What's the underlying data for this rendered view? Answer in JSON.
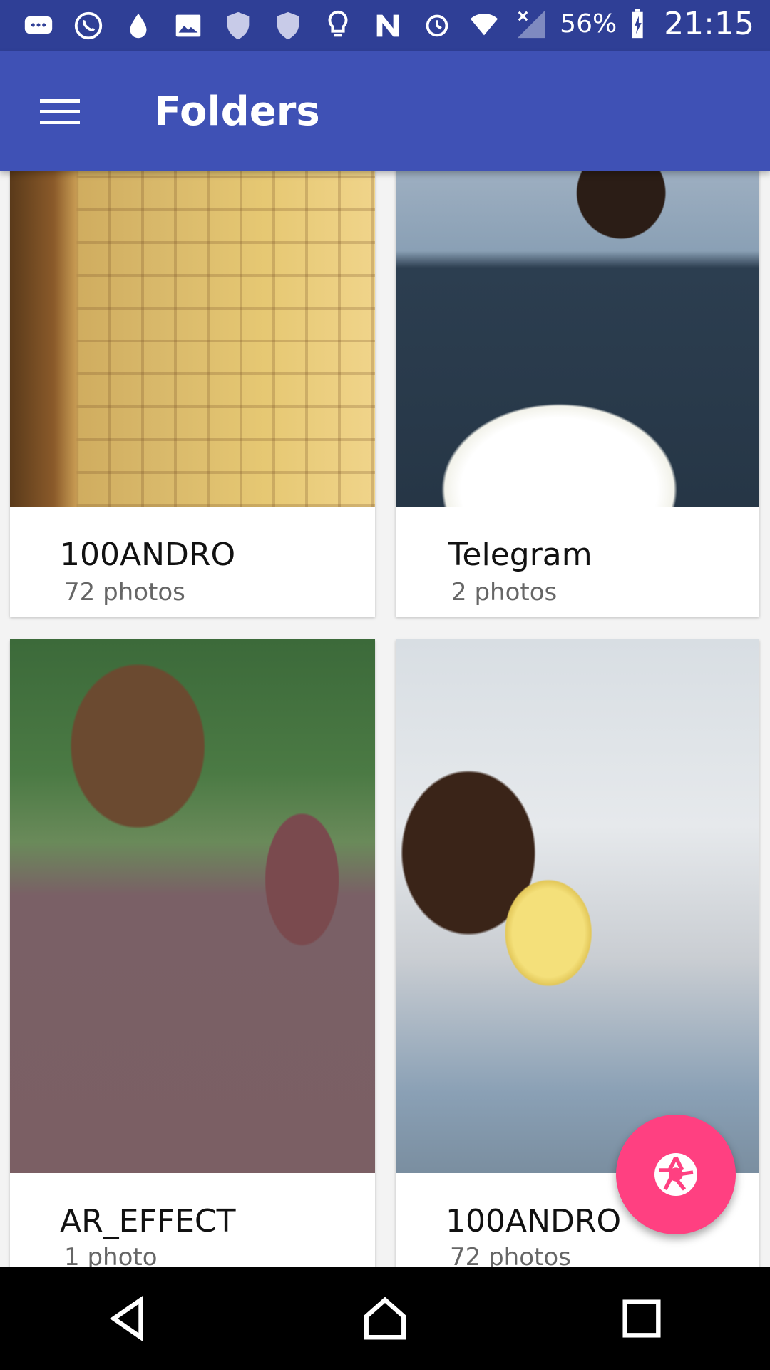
{
  "status_bar": {
    "battery_percent": "56%",
    "time": "21:15",
    "notification_icons": [
      "messaging-icon",
      "whatsapp-icon",
      "water-drop-icon",
      "gallery-icon",
      "shield-icon",
      "shield-icon",
      "lightbulb-icon",
      "n-icon"
    ],
    "system_icons": [
      "alarm-icon",
      "wifi-icon",
      "signal-icon",
      "battery-charging-icon"
    ]
  },
  "app_bar": {
    "title": "Folders",
    "menu_icon": "hamburger-menu-icon"
  },
  "folders": [
    {
      "name": "100ANDRO",
      "count": "72 photos"
    },
    {
      "name": "Telegram",
      "count": "2 photos"
    },
    {
      "name": "AR_EFFECT",
      "count": "1 photo"
    },
    {
      "name": "100ANDRO",
      "count": "72 photos"
    }
  ],
  "fab": {
    "icon": "camera-shutter-icon",
    "color": "#ff4081"
  },
  "colors": {
    "primary": "#3f51b5",
    "primary_dark": "#2f3f96",
    "accent": "#ff4081"
  },
  "nav_bar": {
    "buttons": [
      "back-icon",
      "home-icon",
      "recents-icon"
    ]
  }
}
